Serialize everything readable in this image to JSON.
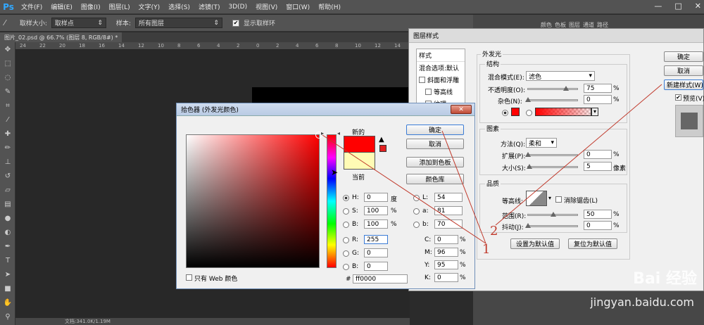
{
  "app": {
    "logo": "Ps"
  },
  "menu": [
    "文件(F)",
    "编辑(E)",
    "图像(I)",
    "图层(L)",
    "文字(Y)",
    "选择(S)",
    "滤镜(T)",
    "3D(D)",
    "视图(V)",
    "窗口(W)",
    "帮助(H)"
  ],
  "window_controls": [
    "—",
    "□",
    "✕"
  ],
  "options": {
    "sample_size_label": "取样大小:",
    "sample_size_value": "取样点",
    "sample_label": "样本:",
    "sample_value": "所有图层",
    "show_ring_label": "显示取样环",
    "show_ring_checked": true
  },
  "document": {
    "tab": "图片_02.psd @ 66.7% (图层 8, RGB/8#) *",
    "status": "文档:341.0K/1.19M"
  },
  "ruler_ticks": [
    "24",
    "22",
    "20",
    "18",
    "16",
    "14",
    "12",
    "10",
    "8",
    "6",
    "4",
    "2",
    "0",
    "2",
    "4",
    "6",
    "8",
    "10",
    "12",
    "14"
  ],
  "right_tabs": [
    "颜色",
    "色板",
    "图层",
    "通道",
    "路径"
  ],
  "layer_style": {
    "title": "图层样式",
    "list": {
      "styles_label": "样式",
      "blend_label": "混合选项:默认",
      "bevel": "斜面和浮雕",
      "contour": "等高线",
      "texture": "纹理"
    },
    "outer_glow_title": "外发光",
    "structure_title": "结构",
    "blend_mode_label": "混合模式(E):",
    "blend_mode_value": "滤色",
    "opacity_label": "不透明度(O):",
    "opacity_value": "75",
    "noise_label": "杂色(N):",
    "noise_value": "0",
    "pct": "%",
    "elements_title": "图素",
    "technique_label": "方法(Q):",
    "technique_value": "柔和",
    "spread_label": "扩展(P):",
    "spread_value": "0",
    "size_label": "大小(S):",
    "size_value": "5",
    "px_unit": "像素",
    "quality_title": "品质",
    "contour_label": "等高线:",
    "antialias_label": "消除锯齿(L)",
    "range_label": "范围(R):",
    "range_value": "50",
    "jitter_label": "抖动(J):",
    "jitter_value": "0",
    "make_default": "设置为默认值",
    "reset_default": "复位为默认值",
    "ok": "确定",
    "cancel": "取消",
    "new_style": "新建样式(W)...",
    "preview_label": "预览(V)"
  },
  "color_picker": {
    "title": "拾色器 (外发光颜色)",
    "new_label": "新的",
    "current_label": "当前",
    "ok": "确定",
    "cancel": "取消",
    "add_swatch": "添加到色板",
    "color_library": "颜色库",
    "web_only_label": "只有 Web 颜色",
    "fields": {
      "H": {
        "label": "H:",
        "value": "0",
        "unit": "度"
      },
      "S": {
        "label": "S:",
        "value": "100",
        "unit": "%"
      },
      "B": {
        "label": "B:",
        "value": "100",
        "unit": "%"
      },
      "R": {
        "label": "R:",
        "value": "255",
        "unit": ""
      },
      "G": {
        "label": "G:",
        "value": "0",
        "unit": ""
      },
      "Bb": {
        "label": "B:",
        "value": "0",
        "unit": ""
      },
      "L": {
        "label": "L:",
        "value": "54",
        "unit": ""
      },
      "a": {
        "label": "a:",
        "value": "81",
        "unit": ""
      },
      "b": {
        "label": "b:",
        "value": "70",
        "unit": ""
      },
      "C": {
        "label": "C:",
        "value": "0",
        "unit": "%"
      },
      "M": {
        "label": "M:",
        "value": "96",
        "unit": "%"
      },
      "Y": {
        "label": "Y:",
        "value": "95",
        "unit": "%"
      },
      "K": {
        "label": "K:",
        "value": "0",
        "unit": "%"
      }
    },
    "hex_label": "#",
    "hex_value": "ff0000"
  },
  "annotations": {
    "one": "1",
    "two": "2"
  },
  "watermark": {
    "brand": "Bai 经验",
    "url": "jingyan.baidu.com"
  },
  "colors": {
    "glow_color": "#ff0000",
    "current_color": "#fffbb5",
    "annotation": "#c0392b"
  }
}
